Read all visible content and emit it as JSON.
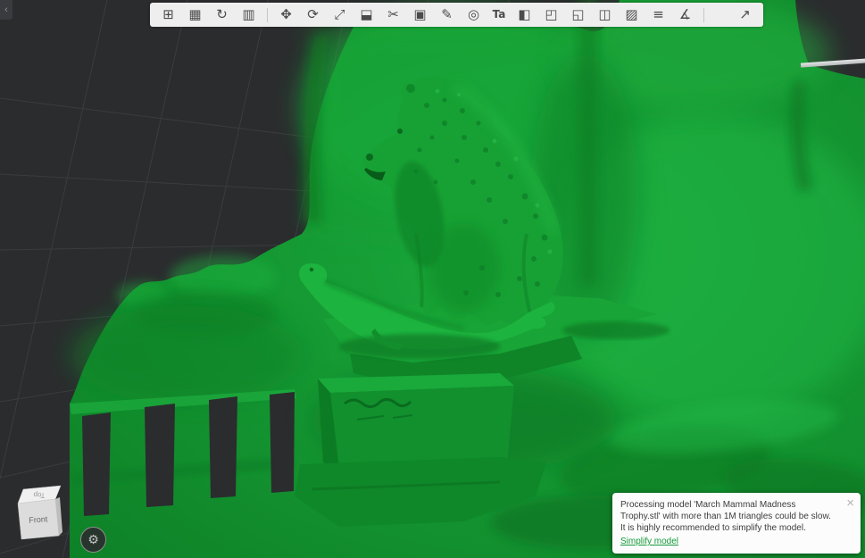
{
  "colors": {
    "viewport_bg": "#2b2c2e",
    "grid_line": "#3b3c3f",
    "toolbar_bg": "#eeeeee",
    "model_green": "#17a134",
    "model_green_light": "#22b445",
    "model_green_dark": "#0d8025",
    "link_green": "#149b38"
  },
  "panel_toggle": {
    "glyph": "‹"
  },
  "toolbar": {
    "icons": [
      {
        "name": "add-object",
        "glyph": "⊞"
      },
      {
        "name": "add-plate",
        "glyph": "▦"
      },
      {
        "name": "auto-orient",
        "glyph": "↻"
      },
      {
        "name": "arrange",
        "glyph": "▥"
      },
      {
        "name": "move",
        "glyph": "✥"
      },
      {
        "name": "rotate",
        "glyph": "⟳"
      },
      {
        "name": "scale",
        "glyph": "⤢"
      },
      {
        "name": "lay-flat",
        "glyph": "⬓"
      },
      {
        "name": "cut",
        "glyph": "✂"
      },
      {
        "name": "clone",
        "glyph": "▣"
      },
      {
        "name": "support-paint",
        "glyph": "✎"
      },
      {
        "name": "seam-paint",
        "glyph": "◎"
      },
      {
        "name": "text-tool",
        "glyph": "Ta"
      },
      {
        "name": "color-paint",
        "glyph": "◧"
      },
      {
        "name": "split-objects",
        "glyph": "◰"
      },
      {
        "name": "split-parts",
        "glyph": "◱"
      },
      {
        "name": "mesh-boolean",
        "glyph": "◫"
      },
      {
        "name": "fuzzy-skin",
        "glyph": "▨"
      },
      {
        "name": "variable-layer-height",
        "glyph": "≡"
      },
      {
        "name": "measure",
        "glyph": "∡"
      },
      {
        "name": "assembly-view",
        "glyph": "↗"
      }
    ]
  },
  "nav_cube": {
    "front_label": "Front",
    "top_label": "Top"
  },
  "gear_button": {
    "glyph": "⚙"
  },
  "notification": {
    "message": "Processing model 'March Mammal Madness Trophy.stl' with more than 1M triangles could be slow. It is highly recommended to simplify the model.",
    "action_label": "Simplify model",
    "close_glyph": "×"
  }
}
